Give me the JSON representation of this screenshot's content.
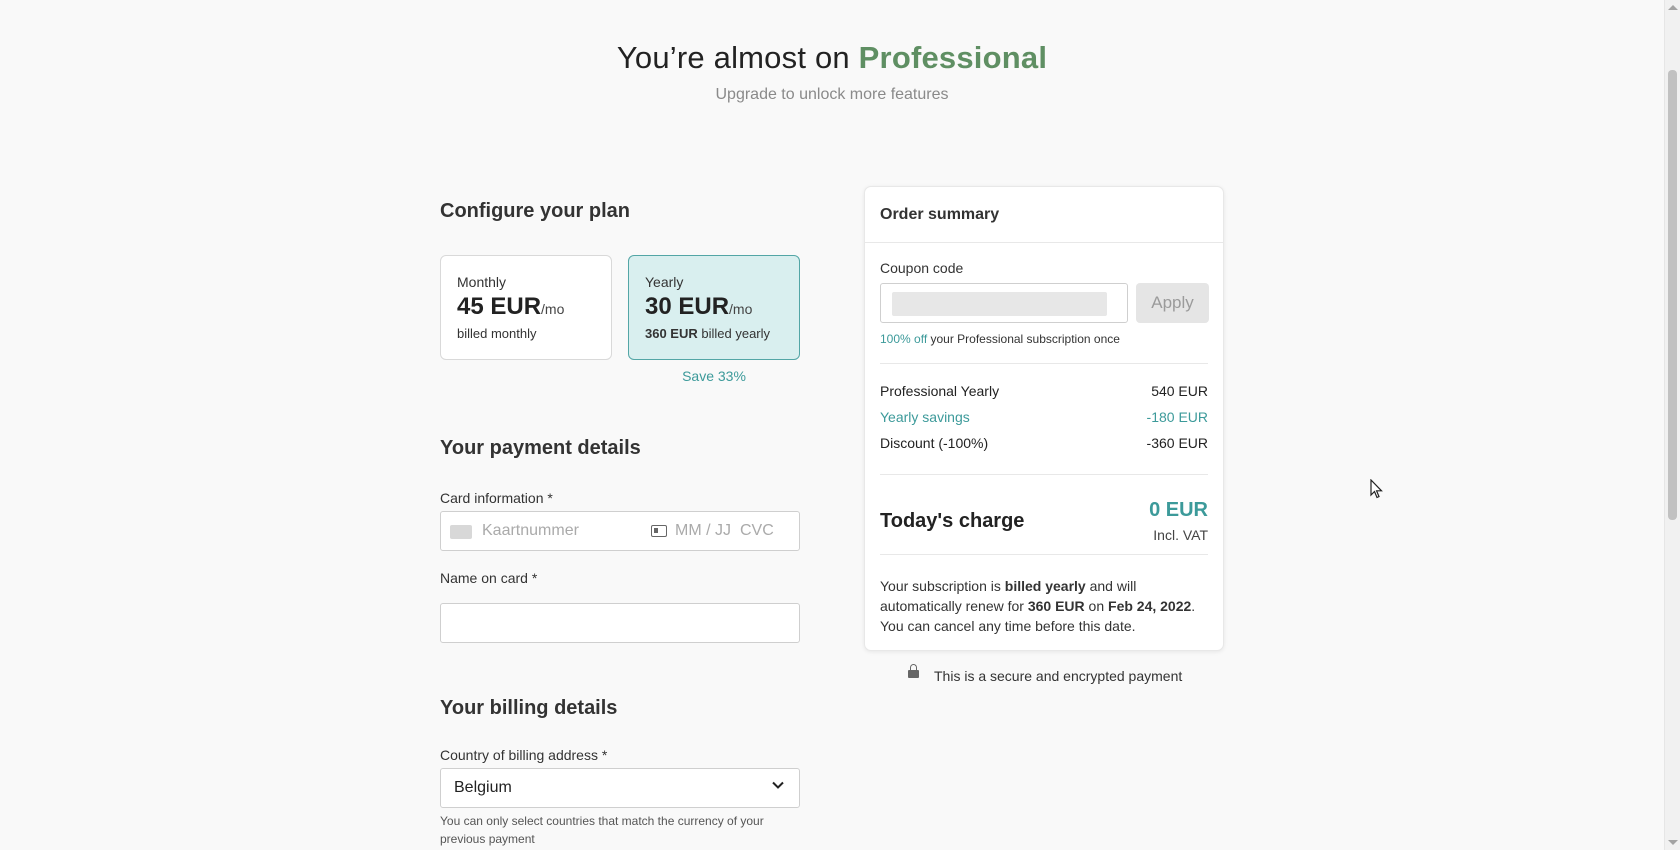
{
  "header": {
    "title_prefix": "You’re almost on",
    "plan_name": "Professional",
    "subtitle": "Upgrade to unlock more features"
  },
  "configure": {
    "title": "Configure your plan",
    "plans": [
      {
        "name": "Monthly",
        "price": "45 EUR",
        "per": "/mo",
        "billed": "billed monthly",
        "selected": false
      },
      {
        "name": "Yearly",
        "price": "30 EUR",
        "per": "/mo",
        "billed_amount": "360 EUR",
        "billed": "billed yearly",
        "selected": true
      }
    ],
    "save_note": "Save 33%"
  },
  "payment": {
    "title": "Your payment details",
    "card_label": "Card information *",
    "card_placeholder": "Kaartnummer",
    "expiry_placeholder": "MM / JJ",
    "cvc_placeholder": "CVC",
    "name_label": "Name on card *",
    "name_value": ""
  },
  "billing": {
    "title": "Your billing details",
    "country_label": "Country of billing address *",
    "country_value": "Belgium",
    "hint": "You can only select countries that match the currency of your previous payment"
  },
  "summary": {
    "title": "Order summary",
    "coupon_label": "Coupon code",
    "apply_label": "Apply",
    "coupon_note_pct": "100% off",
    "coupon_note_rest": " your Professional subscription once",
    "lines": [
      {
        "label": "Professional Yearly",
        "value": "540 EUR",
        "accent": false
      },
      {
        "label": "Yearly savings",
        "value": "-180 EUR",
        "accent": true
      },
      {
        "label": "Discount (-100%)",
        "value": "-360 EUR",
        "accent": false
      }
    ],
    "today_label": "Today's charge",
    "today_amount": "0 EUR",
    "vat_note": "Incl. VAT",
    "renew_1": "Your subscription is ",
    "renew_billed": "billed yearly",
    "renew_2": " and will automatically renew for ",
    "renew_amount": "360 EUR",
    "renew_3": " on ",
    "renew_date": "Feb 24, 2022",
    "renew_4": ". You can cancel any time before this date."
  },
  "secure_note": "This is a secure and encrypted payment",
  "colors": {
    "brand_green": "#5f8f63",
    "accent_teal": "#3c9a9a",
    "selected_bg": "#d9efef"
  },
  "icons": [
    "credit-card-icon",
    "id-card-icon",
    "chevron-down-icon",
    "lock-icon",
    "mouse-cursor-icon"
  ]
}
